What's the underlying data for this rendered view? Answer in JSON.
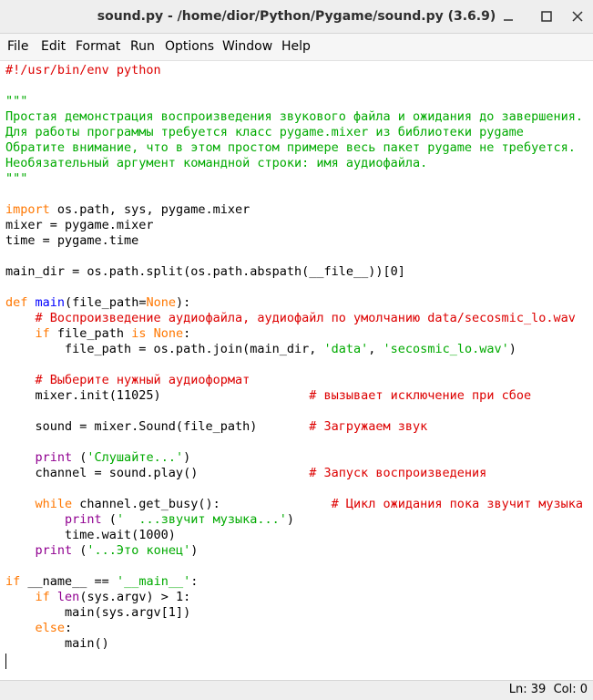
{
  "window": {
    "title": "sound.py - /home/dior/Python/Pygame/sound.py (3.6.9)"
  },
  "menu": {
    "file": "File",
    "edit": "Edit",
    "format": "Format",
    "run": "Run",
    "options": "Options",
    "window": "Window",
    "help": "Help"
  },
  "colors": {
    "keyword": "#ff7700",
    "string": "#00aa00",
    "comment": "#dd0000",
    "definition": "#0000ff",
    "builtin": "#900090"
  },
  "code": {
    "lines": [
      [
        {
          "t": "#!/usr/bin/env python",
          "c": "cm"
        }
      ],
      [],
      [
        {
          "t": "\"\"\"",
          "c": "str"
        }
      ],
      [
        {
          "t": "Простая демонстрация воспроизведения звукового файла и ожидания до завершения.",
          "c": "str"
        }
      ],
      [
        {
          "t": "Для работы программы требуется класс pygame.mixer из библиотеки pygame",
          "c": "str"
        }
      ],
      [
        {
          "t": "Обратите внимание, что в этом простом примере весь пакет pygame не требуется.",
          "c": "str"
        }
      ],
      [
        {
          "t": "Необязательный аргумент командной строки: имя аудиофайла.",
          "c": "str"
        }
      ],
      [
        {
          "t": "\"\"\"",
          "c": "str"
        }
      ],
      [],
      [
        {
          "t": "import",
          "c": "kw"
        },
        {
          "t": " os.path, sys, pygame.mixer"
        }
      ],
      [
        {
          "t": "mixer = pygame.mixer"
        }
      ],
      [
        {
          "t": "time = pygame.time"
        }
      ],
      [],
      [
        {
          "t": "main_dir = os.path.split(os.path.abspath(__file__))[0]"
        }
      ],
      [],
      [
        {
          "t": "def",
          "c": "kw"
        },
        {
          "t": " "
        },
        {
          "t": "main",
          "c": "df"
        },
        {
          "t": "(file_path="
        },
        {
          "t": "None",
          "c": "kw"
        },
        {
          "t": "):"
        }
      ],
      [
        {
          "t": "    "
        },
        {
          "t": "# Воспроизведение аудиофайла, аудиофайл по умолчанию data/secosmic_lo.wav",
          "c": "cm"
        }
      ],
      [
        {
          "t": "    "
        },
        {
          "t": "if",
          "c": "kw"
        },
        {
          "t": " file_path "
        },
        {
          "t": "is",
          "c": "kw"
        },
        {
          "t": " "
        },
        {
          "t": "None",
          "c": "kw"
        },
        {
          "t": ":"
        }
      ],
      [
        {
          "t": "        file_path = os.path.join(main_dir, "
        },
        {
          "t": "'data'",
          "c": "str"
        },
        {
          "t": ", "
        },
        {
          "t": "'secosmic_lo.wav'",
          "c": "str"
        },
        {
          "t": ")"
        }
      ],
      [],
      [
        {
          "t": "    "
        },
        {
          "t": "# Выберите нужный аудиоформат",
          "c": "cm"
        }
      ],
      [
        {
          "t": "    mixer.init(11025)                    "
        },
        {
          "t": "# вызывает исключение при сбое",
          "c": "cm"
        }
      ],
      [],
      [
        {
          "t": "    sound = mixer.Sound(file_path)       "
        },
        {
          "t": "# Загружаем звук",
          "c": "cm"
        }
      ],
      [],
      [
        {
          "t": "    "
        },
        {
          "t": "print",
          "c": "bi"
        },
        {
          "t": " ("
        },
        {
          "t": "'Слушайте...'",
          "c": "str"
        },
        {
          "t": ")"
        }
      ],
      [
        {
          "t": "    channel = sound.play()               "
        },
        {
          "t": "# Запуск воспроизведения",
          "c": "cm"
        }
      ],
      [],
      [
        {
          "t": "    "
        },
        {
          "t": "while",
          "c": "kw"
        },
        {
          "t": " channel.get_busy():               "
        },
        {
          "t": "# Цикл ожидания пока звучит музыка",
          "c": "cm"
        }
      ],
      [
        {
          "t": "        "
        },
        {
          "t": "print",
          "c": "bi"
        },
        {
          "t": " ("
        },
        {
          "t": "'  ...звучит музыка...'",
          "c": "str"
        },
        {
          "t": ")"
        }
      ],
      [
        {
          "t": "        time.wait(1000)"
        }
      ],
      [
        {
          "t": "    "
        },
        {
          "t": "print",
          "c": "bi"
        },
        {
          "t": " ("
        },
        {
          "t": "'...Это конец'",
          "c": "str"
        },
        {
          "t": ")"
        }
      ],
      [],
      [
        {
          "t": "if",
          "c": "kw"
        },
        {
          "t": " __name__ == "
        },
        {
          "t": "'__main__'",
          "c": "str"
        },
        {
          "t": ":"
        }
      ],
      [
        {
          "t": "    "
        },
        {
          "t": "if",
          "c": "kw"
        },
        {
          "t": " "
        },
        {
          "t": "len",
          "c": "bi"
        },
        {
          "t": "(sys.argv) > 1:"
        }
      ],
      [
        {
          "t": "        main(sys.argv[1])"
        }
      ],
      [
        {
          "t": "    "
        },
        {
          "t": "else",
          "c": "kw"
        },
        {
          "t": ":"
        }
      ],
      [
        {
          "t": "        main()"
        }
      ],
      []
    ]
  },
  "status": {
    "position": "Ln: 39  Col: 0"
  }
}
